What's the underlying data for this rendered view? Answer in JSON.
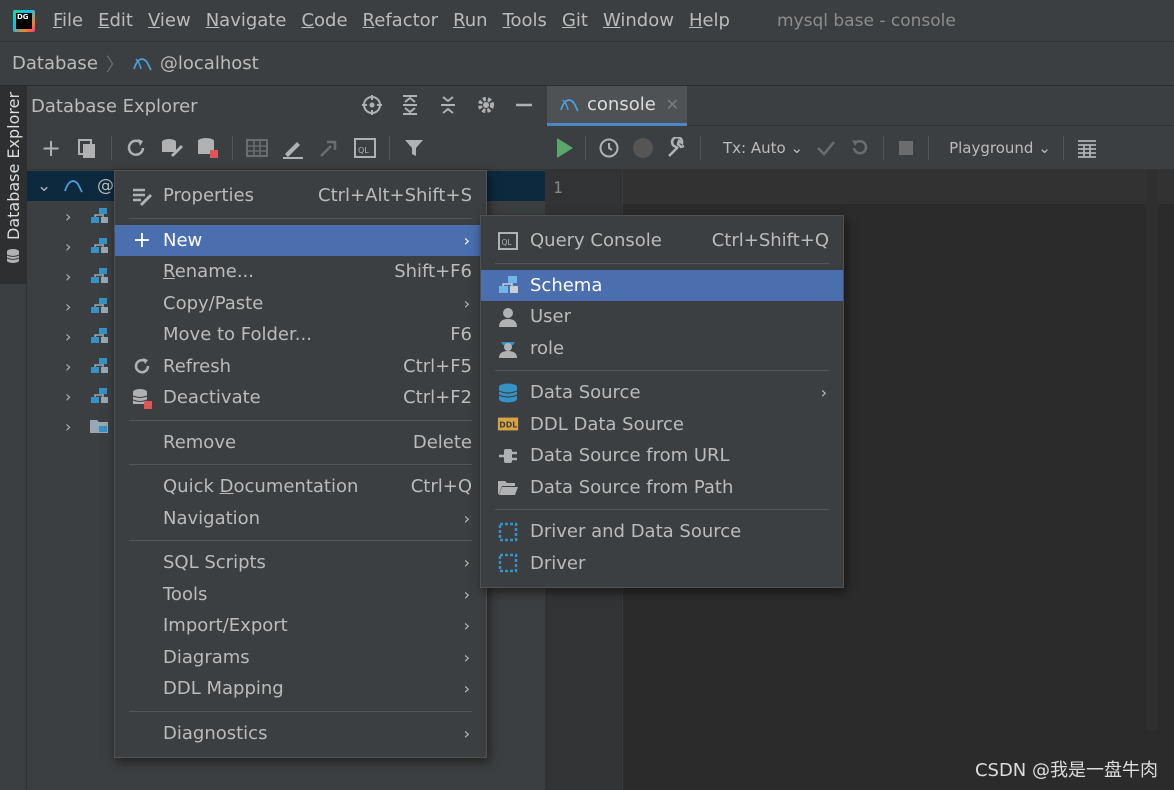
{
  "app": {
    "logo_text": "DG",
    "window_title": "mysql base - console"
  },
  "menubar": {
    "items": [
      {
        "u": "F",
        "rest": "ile"
      },
      {
        "u": "E",
        "rest": "dit"
      },
      {
        "u": "V",
        "rest": "iew"
      },
      {
        "u": "N",
        "rest": "avigate"
      },
      {
        "u": "C",
        "rest": "ode"
      },
      {
        "u": "R",
        "rest": "efactor"
      },
      {
        "u": "R",
        "rest": "un"
      },
      {
        "u": "T",
        "rest": "ools"
      },
      {
        "u": "G",
        "rest": "it"
      },
      {
        "u": "W",
        "rest": "indow"
      },
      {
        "u": "H",
        "rest": "elp"
      }
    ]
  },
  "breadcrumb": {
    "root": "Database",
    "host": "@localhost"
  },
  "left_strip": {
    "tab_label": "Database Explorer"
  },
  "explorer": {
    "title": "Database Explorer",
    "root_prefix": "@"
  },
  "editor": {
    "tab_label": "console",
    "tx_label": "Tx: Auto",
    "playground_label": "Playground",
    "line_number": "1"
  },
  "context_menu": {
    "properties": {
      "label": "Properties",
      "shortcut": "Ctrl+Alt+Shift+S"
    },
    "new": {
      "label": "New"
    },
    "rename": {
      "u": "R",
      "rest": "ename...",
      "shortcut": "Shift+F6"
    },
    "copy_paste": {
      "label": "Copy/Paste"
    },
    "move_to_folder": {
      "label": "Move to Folder...",
      "shortcut": "F6"
    },
    "refresh": {
      "label": "Refresh",
      "shortcut": "Ctrl+F5"
    },
    "deactivate": {
      "label": "Deactivate",
      "shortcut": "Ctrl+F2"
    },
    "remove": {
      "label": "Remove",
      "shortcut": "Delete"
    },
    "quick_doc": {
      "pre": "Quick ",
      "u": "D",
      "rest": "ocumentation",
      "shortcut": "Ctrl+Q"
    },
    "navigation": {
      "label": "Navigation"
    },
    "sql_scripts": {
      "label": "SQL Scripts"
    },
    "tools": {
      "label": "Tools"
    },
    "import_export": {
      "label": "Import/Export"
    },
    "diagrams": {
      "label": "Diagrams"
    },
    "ddl_mapping": {
      "label": "DDL Mapping"
    },
    "diagnostics": {
      "label": "Diagnostics"
    }
  },
  "submenu_new": {
    "query_console": {
      "label": "Query Console",
      "shortcut": "Ctrl+Shift+Q"
    },
    "schema": {
      "label": "Schema"
    },
    "user": {
      "label": "User"
    },
    "role": {
      "label": "role"
    },
    "data_source": {
      "label": "Data Source"
    },
    "ddl_data_source": {
      "label": "DDL Data Source"
    },
    "data_source_url": {
      "label": "Data Source from URL"
    },
    "data_source_path": {
      "label": "Data Source from Path"
    },
    "driver_and_data_source": {
      "label": "Driver and Data Source"
    },
    "driver": {
      "label": "Driver"
    }
  },
  "watermark": "CSDN @我是一盘牛肉",
  "colors": {
    "selection": "#4b6eaf",
    "tree_selection": "#0d293e",
    "run_green": "#59a869",
    "db_blue": "#3592c4",
    "error_red": "#e05555"
  }
}
